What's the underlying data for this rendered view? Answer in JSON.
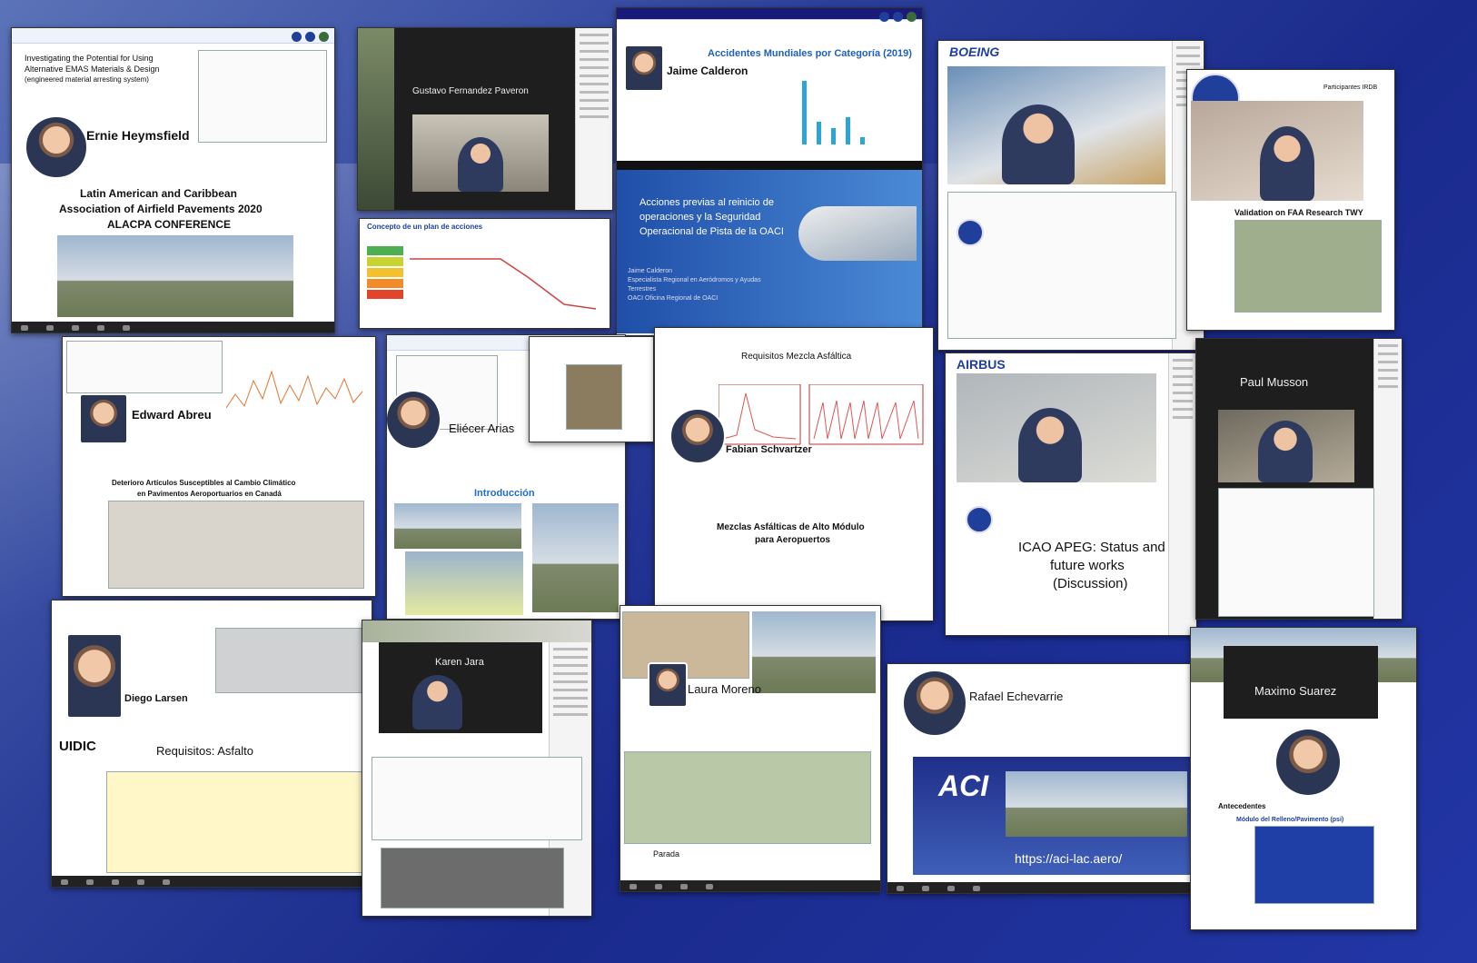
{
  "collage": {
    "ernie": {
      "name": "Ernie Heymsfield",
      "paper_title_1": "Investigating the Potential for Using",
      "paper_title_2": "Alternative EMAS Materials & Design",
      "paper_title_3": "(engineered material arresting system)",
      "conf_1": "Latin American and Caribbean",
      "conf_2": "Association of Airfield Pavements 2020",
      "conf_3": "ALACPA CONFERENCE"
    },
    "gustavo": {
      "name": "Gustavo Fernandez Paveron",
      "chart_title": "Concepto de un plan de acciones"
    },
    "jaime": {
      "name": "Jaime Calderon",
      "chart_title": "Accidentes Mundiales por Categoría (2019)",
      "slide_1": "Acciones previas al reinicio de",
      "slide_2": "operaciones y la Seguridad",
      "slide_3": "Operacional de Pista de la OACI",
      "footer_1": "Jaime Calderon",
      "footer_2": "Especialista Regional en Aeródromos y Ayudas",
      "footer_3": "Terrestres",
      "footer_4": "OACI Oficina Regional de OACI"
    },
    "boeing": {
      "brand": "BOEING"
    },
    "ftw": {
      "header": "Participantes IRDB",
      "slide_title": "Validation on FAA Research TWY"
    },
    "edward": {
      "name": "Edward Abreu",
      "slide_title_1": "Deterioro Artículos Susceptibles al Cambio Climático",
      "slide_title_2": "en Pavimentos Aeroportuarios en Canadá"
    },
    "eliecer": {
      "name": "Eliécer Arias",
      "section": "Introducción"
    },
    "fabian": {
      "name": "Fabian Schvartzer",
      "chart_title": "Requisitos Mezcla Asfáltica",
      "slide_1": "Mezclas Asfálticas de Alto Módulo",
      "slide_2": "para Aeropuertos"
    },
    "airbus": {
      "brand": "AIRBUS",
      "slide_1": "ICAO APEG: Status and",
      "slide_2": "future works",
      "slide_3": "(Discussion)"
    },
    "paul": {
      "name": "Paul Musson"
    },
    "diego": {
      "name": "Diego Larsen",
      "slide_title": "Requisitos: Asfalto",
      "org": "UIDIC"
    },
    "karen": {
      "name": "Karen Jara"
    },
    "laura": {
      "name": "Laura Moreno",
      "legend": "Parada"
    },
    "rafael": {
      "name": "Rafael Echevarrie",
      "url": "https://aci-lac.aero/",
      "logo": "ACI"
    },
    "maximo": {
      "name": "Maximo Suarez",
      "label": "Antecedentes",
      "chart_title": "Módulo del Relleno/Pavimento (psi)"
    }
  }
}
